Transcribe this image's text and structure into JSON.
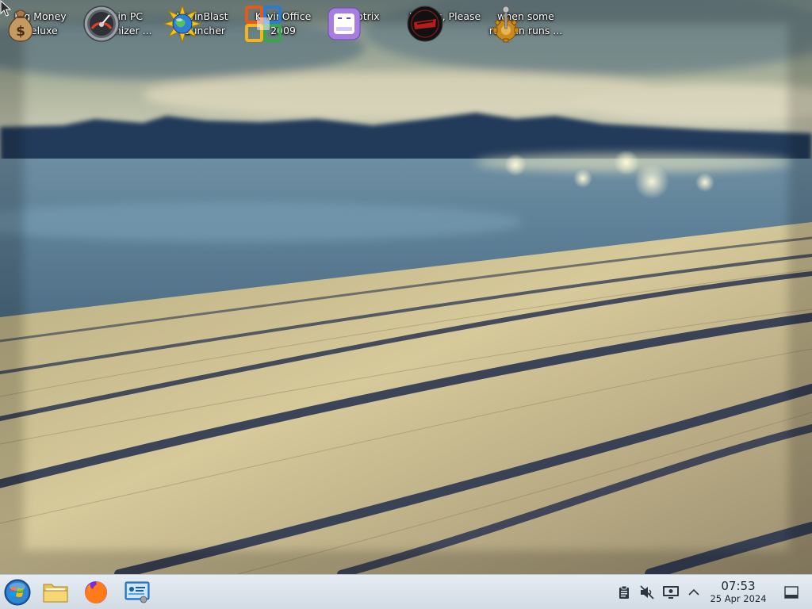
{
  "desktop": {
    "icons": [
      {
        "label": "Big Money\nDeluxe",
        "icon": "money-bag-icon"
      },
      {
        "label": "Kevin PC\nOptimizer ...",
        "icon": "speedometer-icon"
      },
      {
        "label": "KevinBlast\nLauncher",
        "icon": "globe-star-icon"
      },
      {
        "label": "KevinOffice\n2009",
        "icon": "office-logo-icon"
      },
      {
        "label": "Motrix",
        "icon": "motrix-icon"
      },
      {
        "label": "Papers, Please",
        "icon": "papers-please-icon"
      },
      {
        "label": "when some\nrussian runs ...",
        "icon": "joystick-gear-icon"
      }
    ]
  },
  "taskbar": {
    "pinned": [
      {
        "name": "start-menu-button",
        "icon": "windows-orb-icon"
      },
      {
        "name": "file-manager-button",
        "icon": "folder-icon"
      },
      {
        "name": "firefox-button",
        "icon": "firefox-icon"
      },
      {
        "name": "system-settings-button",
        "icon": "settings-panel-icon"
      }
    ],
    "tray": [
      {
        "name": "clipboard-tray",
        "icon": "clipboard-icon"
      },
      {
        "name": "volume-tray",
        "icon": "speaker-muted-icon"
      },
      {
        "name": "network-tray",
        "icon": "monitor-network-icon"
      },
      {
        "name": "tray-expander",
        "icon": "chevron-up-icon"
      }
    ],
    "clock": {
      "time": "07:53",
      "date": "25 Apr 2024"
    },
    "show_desktop": {
      "icon": "show-desktop-icon"
    }
  },
  "colors": {
    "taskbar_bg": "#dde4eb",
    "label_text": "#ffffff",
    "clock_text": "#1c2530"
  }
}
